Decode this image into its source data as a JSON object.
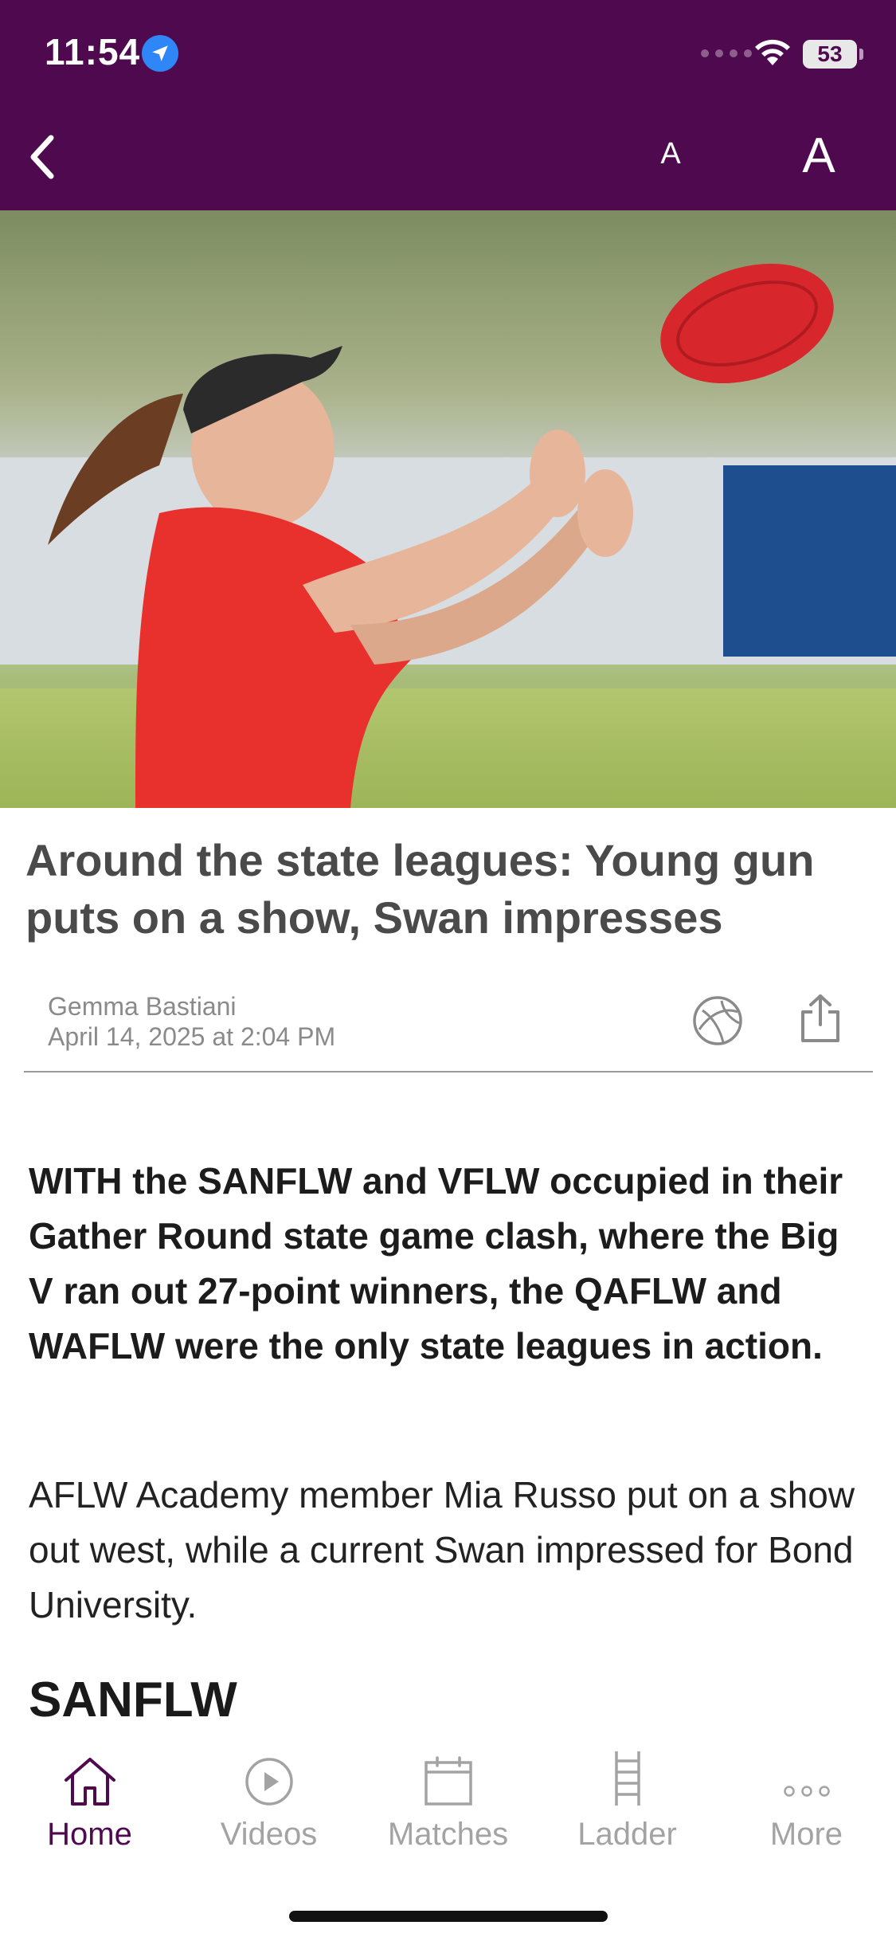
{
  "status_bar": {
    "time": "11:54",
    "battery": "53",
    "icons": [
      "location-arrow-icon",
      "cellular-icon",
      "wifi-icon",
      "battery-icon"
    ]
  },
  "nav": {
    "back_icon": "chevron-left-icon",
    "font_small": "A",
    "font_large": "A"
  },
  "colors": {
    "brand": "#4f0a4f",
    "tab_inactive": "#a3a3a3",
    "meta_text": "#8a8a8a"
  },
  "article": {
    "title": "Around the state leagues: Young gun puts on a show, Swan impresses",
    "author": "Gemma Bastiani",
    "date": "April 14, 2025 at 2:04 PM",
    "lead": "WITH the SANFLW and VFLW occupied in their Gather Round state game clash, where the Big V ran out 27-point winners, the QAFLW and WAFLW were the only state leagues in action.",
    "paragraph": "AFLW Academy member Mia Russo put on a show out west, while a current Swan impressed for Bond University.",
    "section_heading": "SANFLW"
  },
  "tabs": [
    {
      "label": "Home",
      "icon": "home-icon",
      "active": true
    },
    {
      "label": "Videos",
      "icon": "play-circle-icon",
      "active": false
    },
    {
      "label": "Matches",
      "icon": "calendar-icon",
      "active": false
    },
    {
      "label": "Ladder",
      "icon": "ladder-icon",
      "active": false
    },
    {
      "label": "More",
      "icon": "more-dots-icon",
      "active": false
    }
  ]
}
